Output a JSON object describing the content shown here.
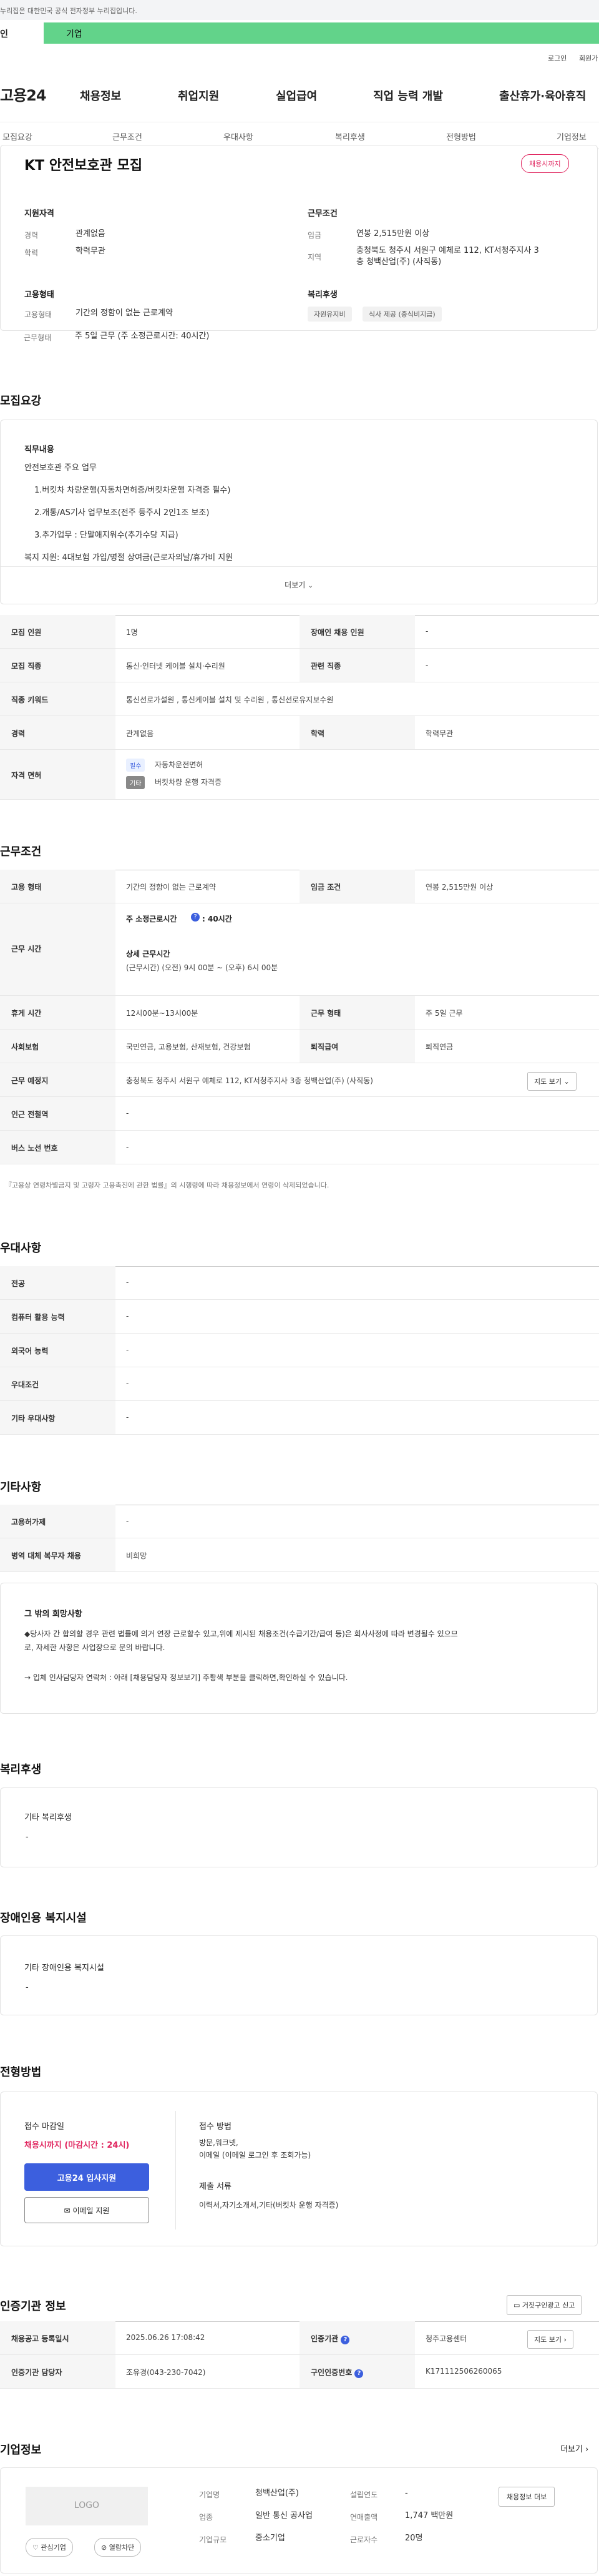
{
  "gov_banner": "누리집은 대한민국 공식 전자정부 누리집입니다.",
  "service_tabs": {
    "personal": "인",
    "corporate": "기업"
  },
  "utility": {
    "login": "로그인",
    "signup": "회원가"
  },
  "logo": "고용24",
  "gnb": [
    "채용정보",
    "취업지원",
    "실업급여",
    "직업 능력 개발",
    "출산휴가·육아휴직"
  ],
  "sub_tabs": [
    "모집요강",
    "근무조건",
    "우대사항",
    "복리후생",
    "전형방법",
    "기업정보"
  ],
  "job": {
    "title": "KT 안전보호관 모집",
    "status_badge": "채용시까지",
    "qual_title": "지원자격",
    "exp_k": "경력",
    "exp_v": "관계없음",
    "edu_k": "학력",
    "edu_v": "학력무관",
    "cond_title": "근무조건",
    "wage_k": "임금",
    "wage_v": "연봉 2,515만원 이상",
    "region_k": "지역",
    "region_v1": "충청북도 청주시 서원구 예체로 112, KT서청주지사 3",
    "region_v2": "층 청백산업(주) (사직동)",
    "emp_title": "고용형태",
    "emp_k": "고용형태",
    "emp_v": "기간의 정함이 없는 근로계약",
    "work_k": "근무형태",
    "work_v": "주 5일 근무 (주 소정근로시간: 40시간)",
    "welfare_title": "복리후생",
    "welfare_tags": [
      "자원유지비",
      "식사 제공 (중식비지급)"
    ]
  },
  "recruit": {
    "section": "모집요강",
    "duty_title": "직무내용",
    "lines": [
      "안전보호관 주요 업무",
      "1.버킷차 차량운행(자동차면허증/버킷차운행 자격증 필수)",
      "2.개통/AS기사 업무보조(전주 등주시 2인1조 보조)",
      "3.추가업무 : 단말애지워수(추가수당 지급)",
      "복지 지원: 4대보험 가입/명절 상여금(근로자의날/휴가비 지원"
    ],
    "more": "더보기"
  },
  "recruit_table": {
    "people_k": "모집 인원",
    "people_v": "1명",
    "disabled_k": "장애인 채용 인원",
    "disabled_v": "-",
    "job_k": "모집 직종",
    "job_v": "통신·인터넷 케이블 설치·수리원",
    "rel_k": "관련 직종",
    "rel_v": "-",
    "kw_k": "직종 키워드",
    "kw_v": "통신선로가설원 , 통신케이블 설치 및 수리원 , 통신선로유지보수원",
    "career_k": "경력",
    "career_v": "관계없음",
    "edu_k": "학력",
    "edu_v": "학력무관",
    "lic_k": "자격 면허",
    "lic_badge1": "필수",
    "lic_v1": "자동차운전면허",
    "lic_badge2": "기타",
    "lic_v2": "버킷차량 운행 자격증"
  },
  "conditions": {
    "section": "근무조건",
    "emp_k": "고용 형태",
    "emp_v": "기간의 정함이 없는 근로계약",
    "pay_k": "임금 조건",
    "pay_v": "연봉 2,515만원 이상",
    "time_k": "근무 시간",
    "weekly": "주 소정근로시간",
    "weekly_v": ": 40시간",
    "detail_title": "상세 근무시간",
    "detail_v": "(근무시간) (오전) 9시 00분 ~ (오후) 6시 00분",
    "rest_k": "휴게 시간",
    "rest_v": "12시00분~13시00분",
    "form_k": "근무 형태",
    "form_v": "주 5일 근무",
    "ins_k": "사회보험",
    "ins_v": "국민연금, 고용보험, 산재보험, 건강보험",
    "sev_k": "퇴직급여",
    "sev_v": "퇴직연금",
    "place_k": "근무 예정지",
    "place_v": "충청북도 청주시 서원구 예체로 112, KT서청주지사 3층 청백산업(주) (사직동)",
    "map_btn": "지도 보기",
    "station_k": "인근 전철역",
    "station_v": "-",
    "bus_k": "버스 노선 번호",
    "bus_v": "-",
    "note": "『고용상 연령차별금지 및 고령자 고용촉진에 관한 법률』의 시행령에 따라 채용정보에서 연령이 삭제되었습니다."
  },
  "preference": {
    "section": "우대사항",
    "rows": [
      {
        "k": "전공",
        "v": "-"
      },
      {
        "k": "컴퓨터 활용 능력",
        "v": "-"
      },
      {
        "k": "외국어 능력",
        "v": "-"
      },
      {
        "k": "우대조건",
        "v": "-"
      },
      {
        "k": "기타 우대사항",
        "v": "-"
      }
    ]
  },
  "others": {
    "section": "기타사항",
    "r1_k": "고용허가제",
    "r1_v": "-",
    "r2_k": "병역 대체 복무자 채용",
    "r2_v": "비희망",
    "box_title": "그 밖의 희망사항",
    "box_l1": "◆당사자 간 합의할 경우 관련 법률에 의거 연장 근로할수 있고,위에 제시된 채용조건(수급기간/급여 등)은 회사사정에 따라 변경될수 있으므",
    "box_l2": "로, 자세한 사항은 사업장으로 문의 바랍니다.",
    "box_l3": "→ 입체 인사담당자 연락처 : 아래 [채용담당자 정보보기] 주황색 부분을 클릭하면,확인하실 수 있습니다."
  },
  "welfare": {
    "section": "복리후생",
    "title": "기타 복리후생",
    "v": "-"
  },
  "disabled": {
    "section": "장애인용 복지시설",
    "title": "기타 장애인용 복지시설",
    "v": "-"
  },
  "screening": {
    "section": "전형방법",
    "deadline_title": "접수 마감일",
    "deadline_v": "채용시까지 (마감시간 : 24시)",
    "apply_btn": "고용24 입사지원",
    "email_btn": "이메일 지원",
    "method_title": "접수 방법",
    "method_v1": "방문,워크넷,",
    "method_v2": "이메일 (이메일 로그인 후 조회가능)",
    "docs_title": "제출 서류",
    "docs_v": "이력서,자기소개서,기타(버킷차 운행 자격증)"
  },
  "agency": {
    "section": "인증기관 정보",
    "report_btn": "거짓구인광고 신고",
    "reg_k": "채용공고 등록일시",
    "reg_v": "2025.06.26 17:08:42",
    "inst_k": "인증기관",
    "inst_v": "청주고용센터",
    "map_btn": "지도 보기",
    "mgr_k": "인증기관 담당자",
    "mgr_v": "조유경(043-230-7042)",
    "num_k": "구인인증번호",
    "num_v": "K171112506260065"
  },
  "company": {
    "section": "기업정보",
    "more": "더보기",
    "logo_text": "LOGO",
    "fav_btn": "관심기업",
    "block_btn": "열람차단",
    "name_k": "기업명",
    "name_v": "청백산업(주)",
    "year_k": "설립연도",
    "year_v": "-",
    "biz_k": "업종",
    "biz_v": "일반 통신 공사업",
    "sales_k": "연매출액",
    "sales_v": "1,747 백만원",
    "size_k": "기업규모",
    "size_v": "중소기업",
    "emp_k": "근로자수",
    "emp_v": "20명",
    "jobs_btn": "채용정보 더보"
  }
}
